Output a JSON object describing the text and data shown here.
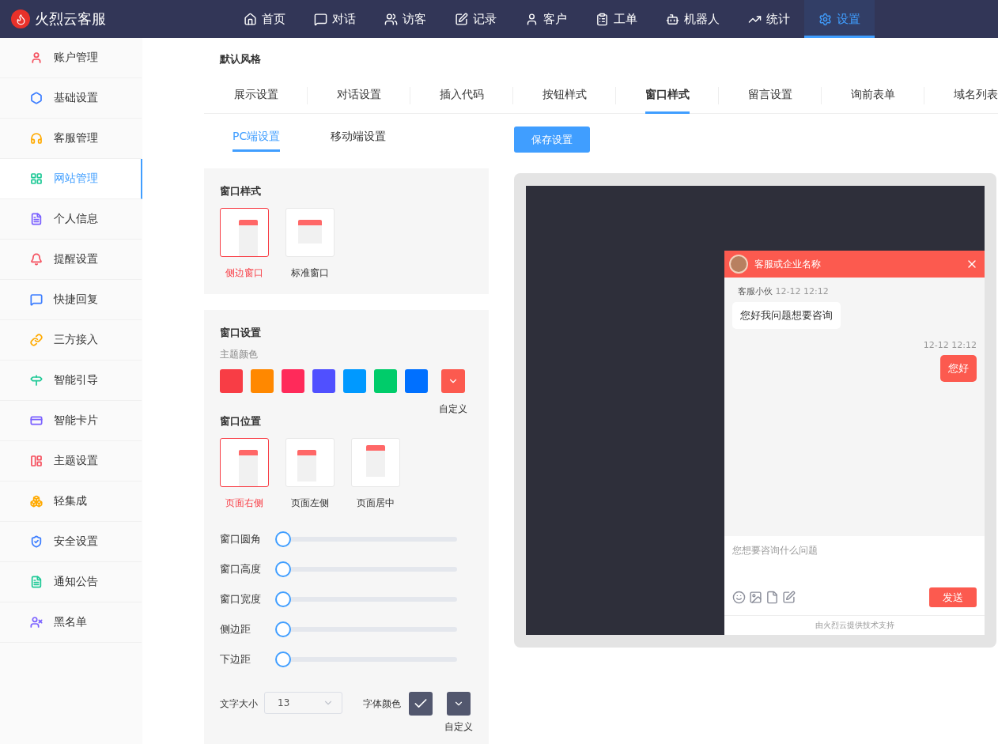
{
  "brand": {
    "name": "火烈云客服"
  },
  "nav": [
    {
      "label": "首页",
      "selected": false
    },
    {
      "label": "对话",
      "selected": false
    },
    {
      "label": "访客",
      "selected": false
    },
    {
      "label": "记录",
      "selected": false
    },
    {
      "label": "客户",
      "selected": false
    },
    {
      "label": "工单",
      "selected": false
    },
    {
      "label": "机器人",
      "selected": false
    },
    {
      "label": "统计",
      "selected": false
    },
    {
      "label": "设置",
      "selected": true
    }
  ],
  "sidebar": {
    "items": [
      {
        "label": "账户管理",
        "color": "#f5515f",
        "selected": false
      },
      {
        "label": "基础设置",
        "color": "#3d7eff",
        "selected": false
      },
      {
        "label": "客服管理",
        "color": "#ffaa00",
        "selected": false
      },
      {
        "label": "网站管理",
        "color": "#20c997",
        "selected": true
      },
      {
        "label": "个人信息",
        "color": "#7b61ff",
        "selected": false
      },
      {
        "label": "提醒设置",
        "color": "#f5515f",
        "selected": false
      },
      {
        "label": "快捷回复",
        "color": "#3d7eff",
        "selected": false
      },
      {
        "label": "三方接入",
        "color": "#ffaa00",
        "selected": false
      },
      {
        "label": "智能引导",
        "color": "#20c997",
        "selected": false
      },
      {
        "label": "智能卡片",
        "color": "#7b61ff",
        "selected": false
      },
      {
        "label": "主题设置",
        "color": "#f5515f",
        "selected": false
      },
      {
        "label": "轻集成",
        "color": "#ffaa00",
        "selected": false
      },
      {
        "label": "安全设置",
        "color": "#3d7eff",
        "selected": false
      },
      {
        "label": "通知公告",
        "color": "#20c997",
        "selected": false
      },
      {
        "label": "黑名单",
        "color": "#7b61ff",
        "selected": false
      }
    ]
  },
  "page_title": "默认风格",
  "tabs": [
    {
      "label": "展示设置",
      "selected": false
    },
    {
      "label": "对话设置",
      "selected": false
    },
    {
      "label": "插入代码",
      "selected": false
    },
    {
      "label": "按钮样式",
      "selected": false
    },
    {
      "label": "窗口样式",
      "selected": true
    },
    {
      "label": "留言设置",
      "selected": false
    },
    {
      "label": "询前表单",
      "selected": false
    },
    {
      "label": "域名列表",
      "selected": false
    }
  ],
  "subtabs": [
    {
      "label": "PC端设置",
      "selected": true
    },
    {
      "label": "移动端设置",
      "selected": false
    }
  ],
  "save_button": "保存设置",
  "window_style": {
    "title": "窗口样式",
    "options": [
      {
        "kind": "side",
        "label": "侧边窗口",
        "selected": true
      },
      {
        "kind": "standard",
        "label": "标准窗口",
        "selected": false
      }
    ]
  },
  "window_settings": {
    "title": "窗口设置",
    "theme_label": "主题颜色",
    "swatches": [
      {
        "color": "#f83d45"
      },
      {
        "color": "#ff8800"
      },
      {
        "color": "#ff2a5a"
      },
      {
        "color": "#5050ff"
      },
      {
        "color": "#0099ff"
      },
      {
        "color": "#00cc6a"
      },
      {
        "color": "#0070ff"
      }
    ],
    "custom_label": "自定义",
    "position_title": "窗口位置",
    "positions": [
      {
        "kind": "right",
        "label": "页面右侧",
        "selected": true
      },
      {
        "kind": "left",
        "label": "页面左侧",
        "selected": false
      },
      {
        "kind": "center",
        "label": "页面居中",
        "selected": false
      }
    ],
    "sliders": [
      {
        "label": "窗口圆角",
        "level": 0
      },
      {
        "label": "窗口高度",
        "level": 0
      },
      {
        "label": "窗口宽度",
        "level": 0
      },
      {
        "label": "侧边距",
        "level": 0
      },
      {
        "label": "下边距",
        "level": 0
      }
    ],
    "font_size": {
      "label": "文字大小",
      "value": "13"
    },
    "font_color": {
      "label": "字体颜色",
      "custom_label": "自定义"
    }
  },
  "preview": {
    "header_title": "客服或企业名称",
    "agent": "客服小伙",
    "agent_time": "12-12 12:12",
    "agent_message": "您好我问题想要咨询",
    "user_time": "12-12 12:12",
    "user_message": "您好",
    "input_placeholder": "您想要咨询什么问题",
    "send_button": "发送",
    "footer": "由火烈云提供技术支持"
  }
}
